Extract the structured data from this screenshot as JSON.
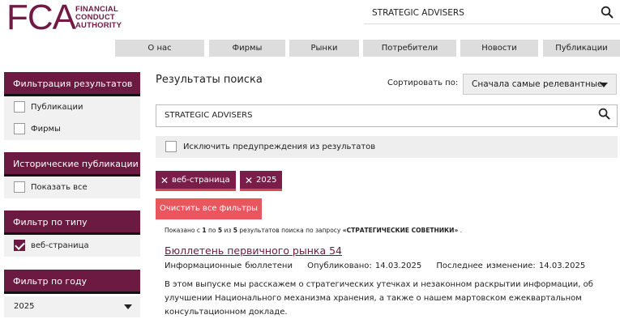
{
  "logo": {
    "letters": "FCA",
    "line1": "FINANCIAL",
    "line2": "CONDUCT",
    "line3": "AUTHORITY",
    "color": "#701b45"
  },
  "header": {
    "search_value": "STRATEGIC ADVISERS",
    "search_icon": "search-icon"
  },
  "nav": [
    "О нас",
    "Фирмы",
    "Рынки",
    "Потребители",
    "Новости",
    "Публикации"
  ],
  "sidebar": {
    "filter_title": "Фильтрация результатов",
    "filter_items": [
      {
        "label": "Публикации",
        "checked": false
      },
      {
        "label": "Фирмы",
        "checked": false
      }
    ],
    "historic_title": "Исторические публикации",
    "historic_item": {
      "label": "Показать все",
      "checked": false
    },
    "doctype_title": "Фильтр по типу документа",
    "doctype_item": {
      "label": "веб-страница",
      "checked": true
    },
    "year_title": "Фильтр по году",
    "year_value": "2025"
  },
  "main": {
    "title": "Результаты поиска",
    "sort_label": "Сортировать по:",
    "sort_value": "Сначала самые релевантные",
    "search_value": "STRATEGIC ADVISERS",
    "exclude_label": "Исключить предупреждения из результатов",
    "chips": [
      "веб-страница",
      "2025"
    ],
    "clear_label": "Очистить все фильтры",
    "summary_pre": "Показано с",
    "summary_from": "1",
    "summary_to_word": "по",
    "summary_to": "5",
    "summary_of_word": "из",
    "summary_total": "5",
    "summary_mid": "результатов поиска по запросу",
    "summary_query": "«СТРАТЕГИЧЕСКИЕ СОВЕТНИКИ»",
    "summary_end": ".",
    "result": {
      "title": "Бюллетень первичного рынка 54",
      "type": "Информационные бюллетени",
      "published": "Опубликовано: 14.03.2025",
      "modified": "Последнее изменение: 14.03.2025",
      "description": "В этом выпуске мы расскажем о стратегических утечках и незаконном раскрытии информации, об улучшении Национального механизма хранения, а также о нашем мартовском ежеквартальном консультационном докладе."
    }
  },
  "colors": {
    "brand": "#6c1a42",
    "chip": "#7a1d49",
    "clear": "#e8575e"
  }
}
